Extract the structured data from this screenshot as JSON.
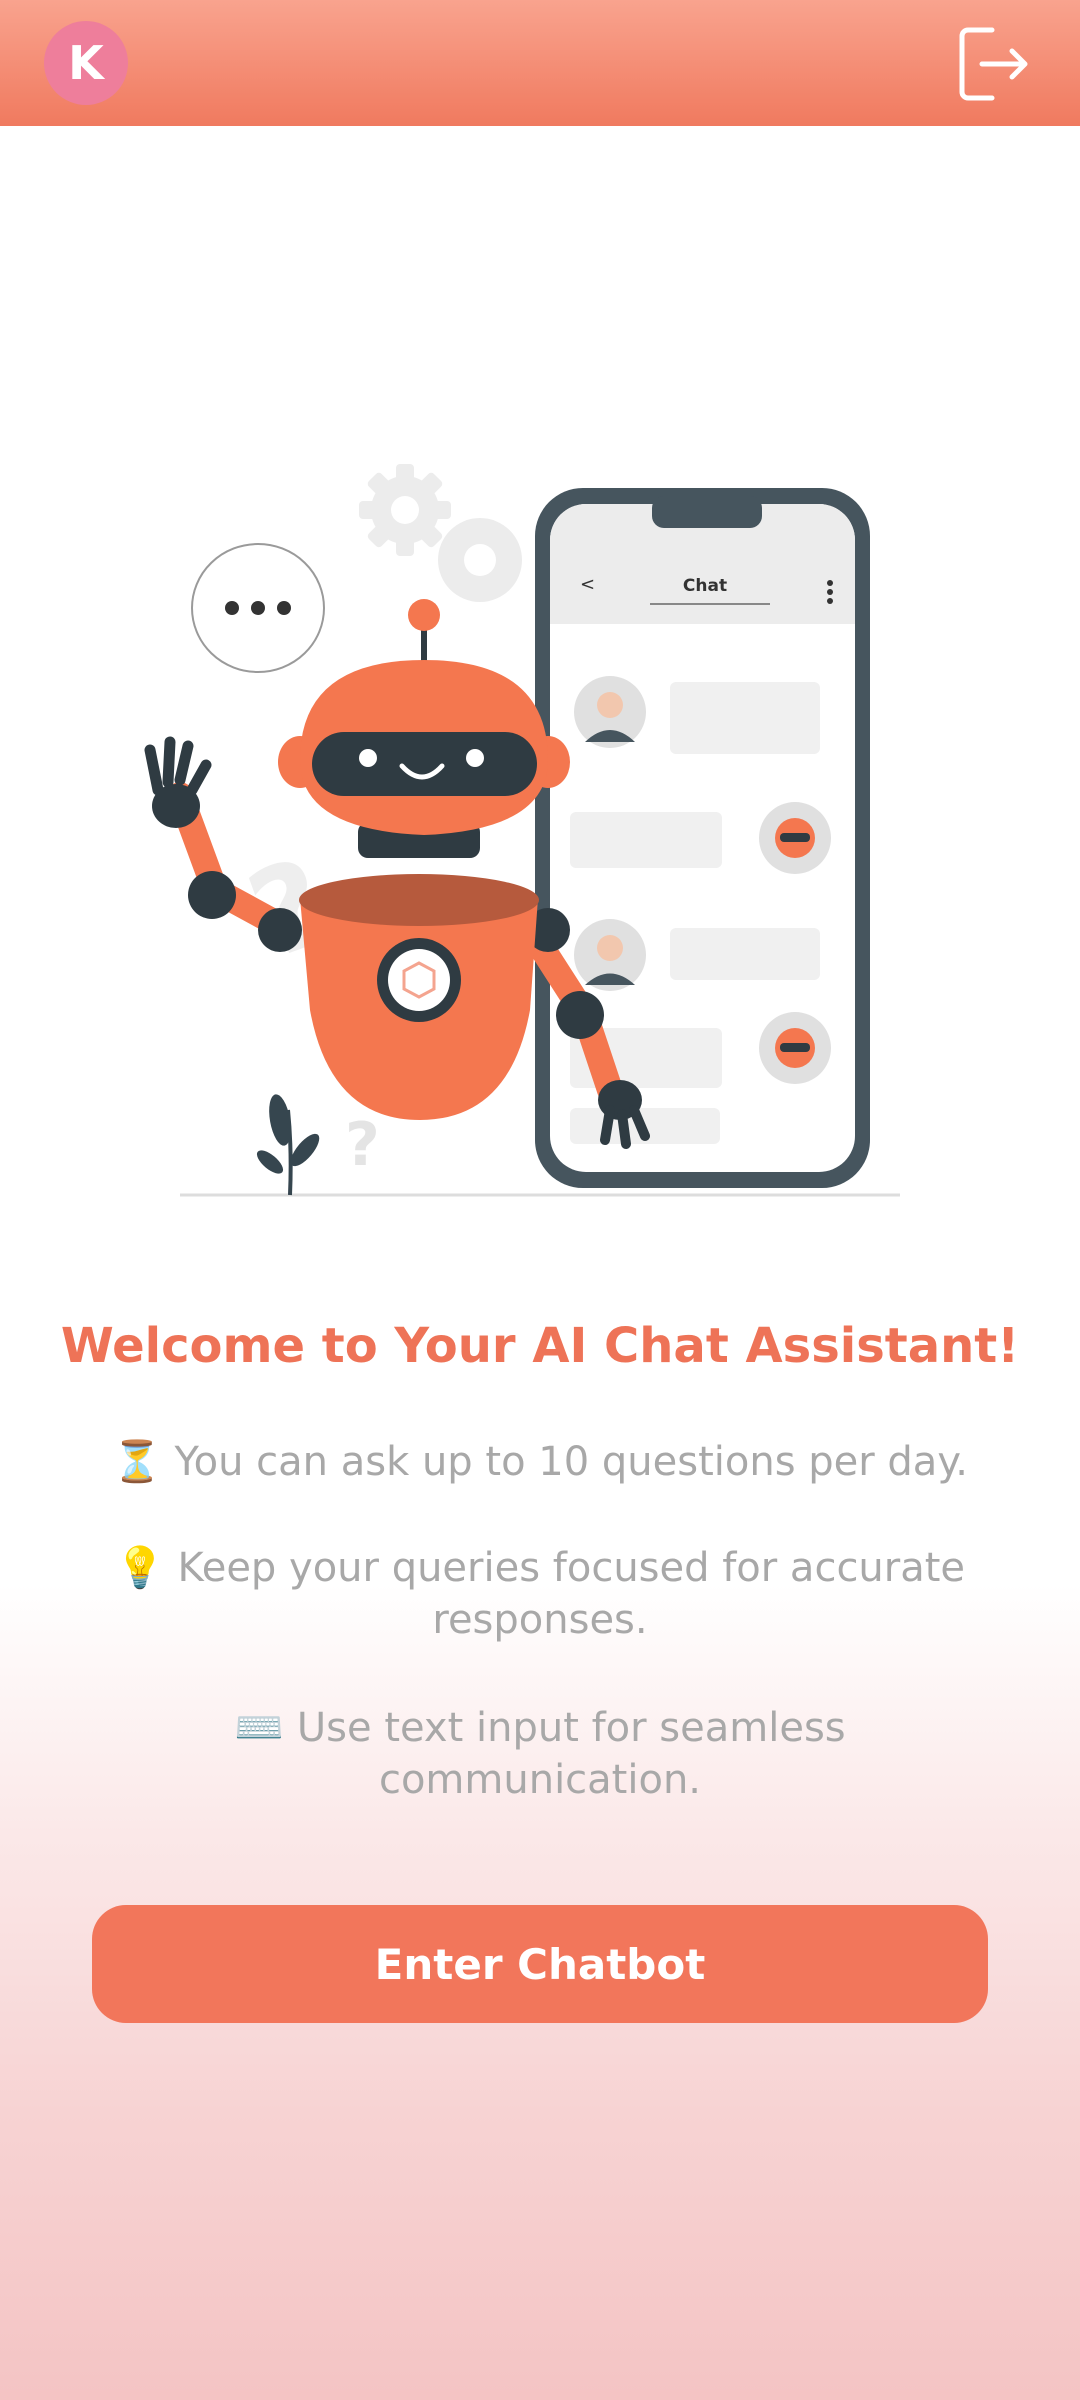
{
  "header": {
    "avatar_initial": "K",
    "logout_icon": "logout-icon"
  },
  "illustration": {
    "phone_header_title": "Chat",
    "phone_back_glyph": "<"
  },
  "welcome": {
    "title": "Welcome to Your AI Chat Assistant!",
    "tips": [
      "⏳ You can ask up to 10 questions per day.",
      "💡 Keep your queries focused for accurate responses.",
      "⌨️ Use text input for seamless communication."
    ]
  },
  "actions": {
    "enter_label": "Enter Chatbot"
  },
  "colors": {
    "accent": "#f2765b",
    "title": "#ee7357",
    "avatar": "#ee7e9b",
    "robot": "#f4774f",
    "dark": "#36464f"
  }
}
